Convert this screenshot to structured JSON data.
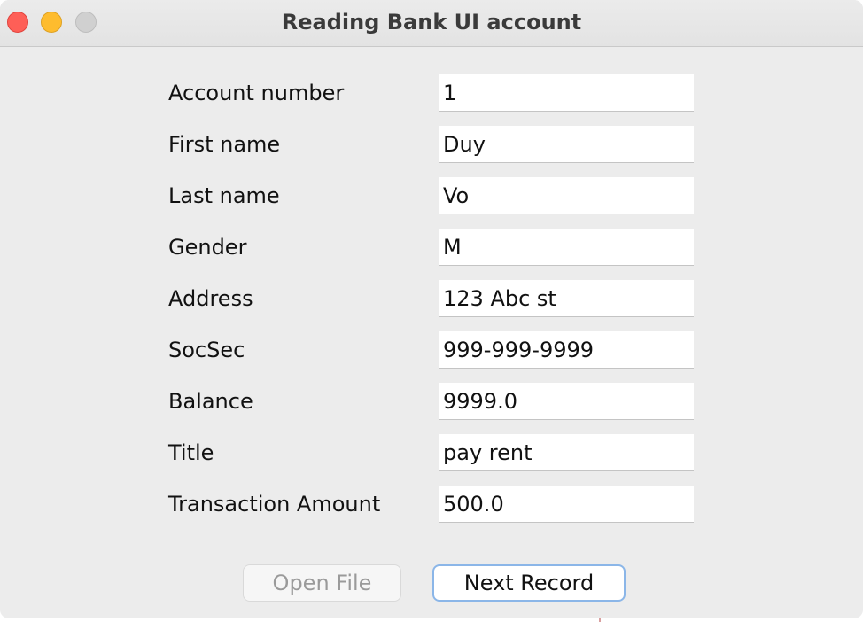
{
  "window": {
    "title": "Reading Bank UI account"
  },
  "form": {
    "fields": [
      {
        "label": "Account number",
        "value": "1"
      },
      {
        "label": "First name",
        "value": "Duy"
      },
      {
        "label": "Last name",
        "value": "Vo"
      },
      {
        "label": "Gender",
        "value": "M"
      },
      {
        "label": "Address",
        "value": "123 Abc st"
      },
      {
        "label": "SocSec",
        "value": "999-999-9999"
      },
      {
        "label": "Balance",
        "value": "9999.0"
      },
      {
        "label": "Title",
        "value": "pay rent"
      },
      {
        "label": "Transaction Amount",
        "value": "500.0"
      }
    ]
  },
  "buttons": {
    "open_file": "Open File",
    "next_record": "Next Record"
  },
  "colors": {
    "close": "#fe5f57",
    "minimize": "#febc2e",
    "zoom_disabled": "#d0d0d0",
    "focus_ring": "#8bb6e8"
  }
}
